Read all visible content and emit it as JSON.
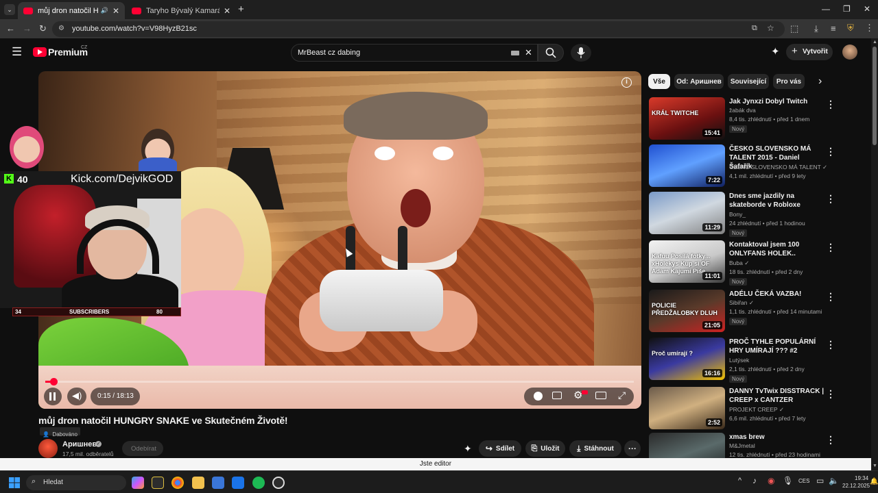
{
  "browser": {
    "tabs": [
      {
        "title": "můj dron natočil HUNGRY S",
        "active": true
      },
      {
        "title": "Taryho Bývalý Kamarád Se Otoč",
        "active": false
      }
    ],
    "new_tab": "+",
    "url": "youtube.com/watch?v=V98HyzB21sc"
  },
  "youtube": {
    "logo": "Premium",
    "logo_region": "CZ",
    "search_value": "MrBeast cz dabing",
    "create_label": "Vytvořit"
  },
  "video": {
    "facecam_kick_count": "40",
    "facecam_kick_url": "Kick.com/DejvikGOD",
    "sub_goal_left": "34",
    "sub_goal_label": "SUBSCRIBERS",
    "sub_goal_right": "80",
    "time": "0:15 / 18:13",
    "progress_fraction": 0.014,
    "title": "můj dron natočil HUNGRY SNAKE ve Skutečném Životě!",
    "dub_label": "Dabováno"
  },
  "channel": {
    "name": "Аришнев",
    "subscribers": "17,5 mil. odběratelů",
    "subscribe_label": "Odebírat"
  },
  "actions": {
    "share": "Sdílet",
    "save": "Uložit",
    "download": "Stáhnout"
  },
  "chips": [
    "Vše",
    "Od: Аришнев",
    "Související",
    "Pro vás"
  ],
  "recommendations": [
    {
      "title": "Jak Jynxzi Dobyl Twitch",
      "channel": "žabák dva",
      "meta": "8,4 tis. zhlédnutí • před 1 dnem",
      "badge": "Nový",
      "duration": "15:41",
      "thumb_text": "KRÁL TWITCHE",
      "verified": false
    },
    {
      "title": "ČESKO SLOVENSKO MÁ TALENT 2015 - Daniel Šafařík",
      "channel": "ČESKO SLOVENSKO MÁ TALENT",
      "meta": "4,1 mil. zhlédnutí • před 9 lety",
      "badge": "",
      "duration": "7:22",
      "thumb_text": "",
      "verified": true
    },
    {
      "title": "Dnes sme jazdily na skateborde v Robloxe",
      "channel": "Bony_",
      "meta": "24 zhlédnutí • před 1 hodinou",
      "badge": "Nový",
      "duration": "11:29",
      "thumb_text": "",
      "verified": false
    },
    {
      "title": "Kontaktoval jsem 100 ONLYFANS HOLEK..",
      "channel": "Buba",
      "meta": "18 tis. zhlédnutí • před 2 dny",
      "badge": "Nový",
      "duration": "11:01",
      "thumb_text": "Kafuu Posílá fotky... xHolekys Kup si OF Adam Kajumi Píše...",
      "verified": true
    },
    {
      "title": "ADÉLU ČEKÁ VAZBA!",
      "channel": "Sibiřan",
      "meta": "1,1 tis. zhlédnutí • před 14 minutami",
      "badge": "Nový",
      "duration": "21:05",
      "thumb_text": "POLICIE PŘEDŽALOBKY DLUH",
      "verified": true
    },
    {
      "title": "PROČ TYHLE POPULÁRNÍ HRY UMÍRAJÍ ??? #2",
      "channel": "Lutýsek",
      "meta": "2,1 tis. zhlédnutí • před 2 dny",
      "badge": "Nový",
      "duration": "16:16",
      "thumb_text": "Proč umírají ?",
      "verified": false
    },
    {
      "title": "DANNY TvTwix DISSTRACK | CREEP x CANTZER",
      "channel": "PROJEKT CREEP",
      "meta": "6,6 mil. zhlédnutí • před 7 lety",
      "badge": "",
      "duration": "2:52",
      "thumb_text": "",
      "verified": true
    },
    {
      "title": "xmas brew",
      "channel": "M&Jmetal",
      "meta": "12 tis. zhlédnutí • před 23 hodinami",
      "badge": "",
      "duration": "",
      "thumb_text": "",
      "verified": false
    }
  ],
  "editor_banner": "Jste editor",
  "taskbar": {
    "search_placeholder": "Hledat",
    "language": "CES",
    "time": "19:34",
    "date": "22.12.2025"
  },
  "colors": {
    "yt_red": "#ff0033",
    "page_bg": "#0f0f0f",
    "chip_bg": "#272727"
  }
}
